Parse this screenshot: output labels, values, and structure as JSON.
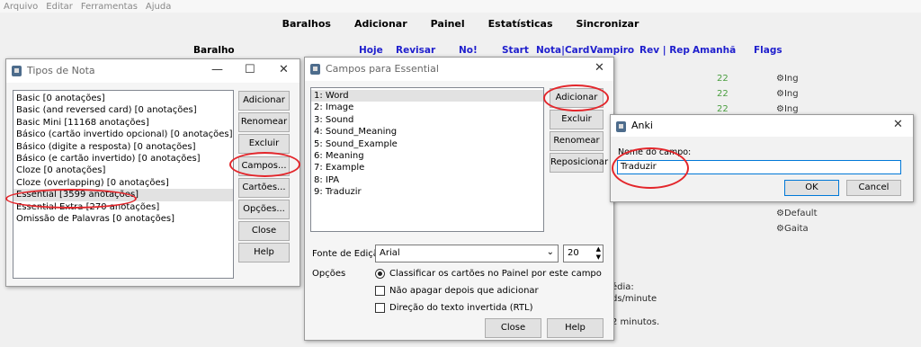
{
  "menu": [
    "Arquivo",
    "Editar",
    "Ferramentas",
    "Ajuda"
  ],
  "toolbar": [
    "Baralhos",
    "Adicionar",
    "Painel",
    "Estatísticas",
    "Sincronizar"
  ],
  "deck_headers": {
    "deck": "Baralho",
    "today": "Hoje",
    "review": "Revisar",
    "no": "No!",
    "start": "Start",
    "note_card": "Nota|Card",
    "leech": "Vampiro",
    "rev_rep": "Rev | Rep",
    "tomorrow": "Amanhã",
    "flags": "Flags"
  },
  "deck_rows": [
    {
      "tomorrow": "22",
      "flag": "Ing"
    },
    {
      "tomorrow": "22",
      "flag": "Ing"
    },
    {
      "tomorrow": "22",
      "flag": "Ing"
    }
  ],
  "deck_rows_lower": [
    {
      "flag": "Default"
    },
    {
      "flag": "Gaita"
    }
  ],
  "stats_fragments": [
    "édia:",
    "ds/minute",
    "2 minutos."
  ],
  "note_types": {
    "title": "Tipos de Nota",
    "items": [
      "Basic [0 anotações]",
      "Basic (and reversed card) [0 anotações]",
      "Basic Mini [11168 anotações]",
      "Básico (cartão invertido opcional) [0 anotações]",
      "Básico (digite a resposta) [0 anotações]",
      "Básico (e cartão invertido) [0 anotações]",
      "Cloze [0 anotações]",
      "Cloze (overlapping) [0 anotações]",
      "Essential [3599 anotações]",
      "Essential Extra [270 anotações]",
      "Omissão de Palavras [0 anotações]"
    ],
    "selected_index": 8,
    "buttons": {
      "add": "Adicionar",
      "rename": "Renomear",
      "delete": "Excluir",
      "fields": "Campos...",
      "cards": "Cartões...",
      "options": "Opções...",
      "close": "Close",
      "help": "Help"
    }
  },
  "fields": {
    "title": "Campos para Essential",
    "items": [
      "1: Word",
      "2: Image",
      "3: Sound",
      "4: Sound_Meaning",
      "5: Sound_Example",
      "6: Meaning",
      "7: Example",
      "8: IPA",
      "9: Traduzir"
    ],
    "selected_index": 0,
    "buttons": {
      "add": "Adicionar",
      "delete": "Excluir",
      "rename": "Renomear",
      "reposition": "Reposicionar",
      "close": "Close",
      "help": "Help"
    },
    "font_label": "Fonte de Edição",
    "font_value": "Arial",
    "font_size": "20",
    "options_label": "Opções",
    "opt_sort": "Classificar os cartões no Painel por este campo",
    "opt_remember": "Não apagar depois que adicionar",
    "opt_rtl": "Direção do texto invertida (RTL)"
  },
  "anki": {
    "title": "Anki",
    "field_label": "Nome do campo:",
    "field_value": "Traduzir",
    "ok": "OK",
    "cancel": "Cancel"
  }
}
